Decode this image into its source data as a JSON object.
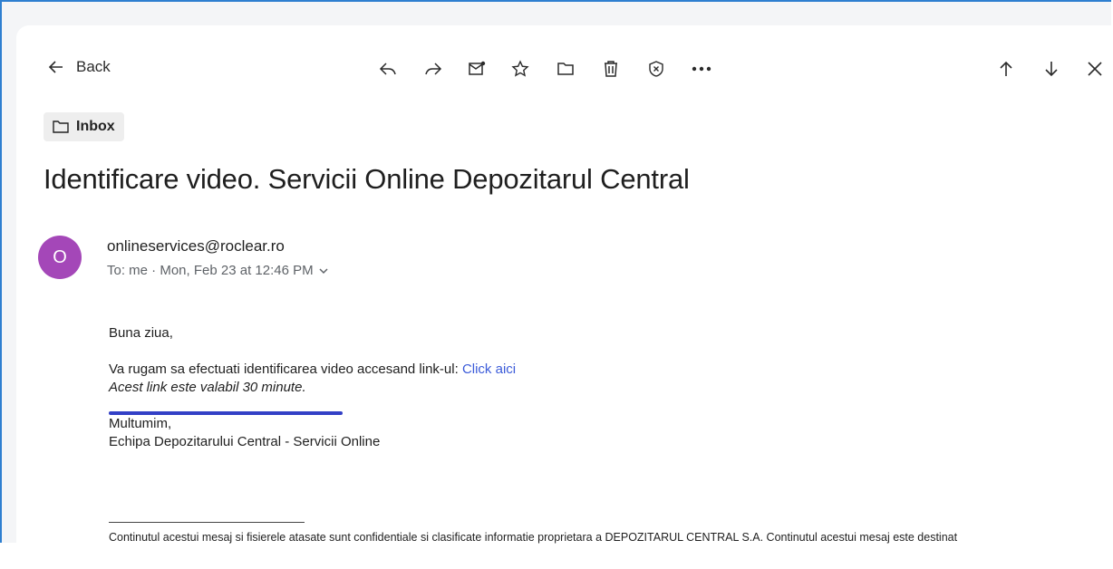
{
  "toolbar": {
    "back_label": "Back",
    "icons": [
      "reply-icon",
      "forward-icon",
      "mark-unread-icon",
      "star-icon",
      "folder-icon",
      "delete-icon",
      "block-icon",
      "more-icon"
    ],
    "nav_icons": [
      "arrow-up-icon",
      "arrow-down-icon",
      "close-icon"
    ]
  },
  "folder": {
    "label": "Inbox"
  },
  "message": {
    "subject": "Identificare video. Servicii Online Depozitarul Central",
    "avatar_letter": "O",
    "avatar_color": "#a447b8",
    "sender": "onlineservices@roclear.ro",
    "meta": "To: me · Mon, Feb 23 at 12:46 PM",
    "body": {
      "greeting": "Buna ziua,",
      "line1": "Va rugam sa efectuati identificarea video accesand link-ul: ",
      "link": "Click aici",
      "line2": "Acest link este valabil 30 minute.",
      "thanks": "Multumim,",
      "team": "Echipa Depozitarului Central - Servicii Online",
      "disclaimer": "Continutul acestui mesaj si fisierele atasate sunt confidentiale si clasificate informatie proprietara a DEPOZITARUL CENTRAL S.A. Continutul acestui mesaj este destinat"
    }
  },
  "colors": {
    "accent_frame": "#2e7fd0",
    "link": "#3b5bd9",
    "annotation": "#3340c6"
  }
}
